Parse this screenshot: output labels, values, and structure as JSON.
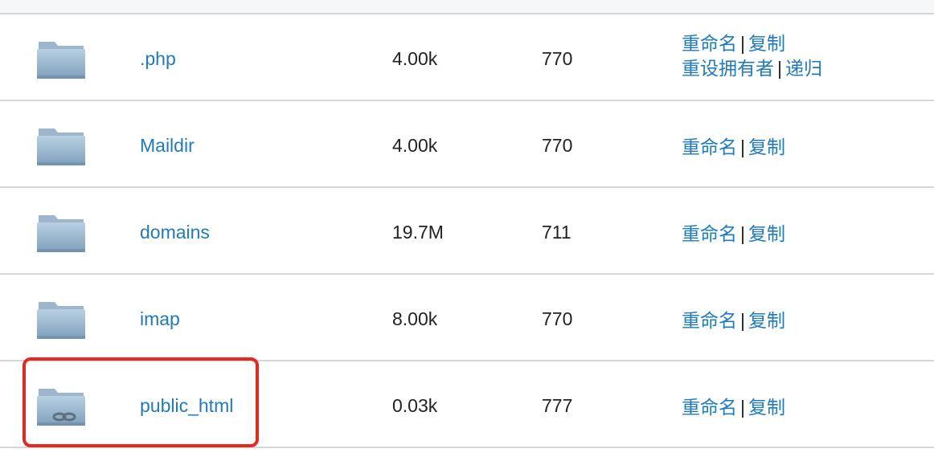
{
  "files": [
    {
      "name": ".php",
      "size": "4.00k",
      "permissions": "770",
      "icon": "folder-icon",
      "symlink": false,
      "actions": {
        "rename": "重命名",
        "separator": "|",
        "copy": "复制",
        "reset_owner": "重设拥有者",
        "recursive": "递归"
      }
    },
    {
      "name": "Maildir",
      "size": "4.00k",
      "permissions": "770",
      "icon": "folder-icon",
      "symlink": false,
      "actions": {
        "rename": "重命名",
        "separator": "|",
        "copy": "复制"
      }
    },
    {
      "name": "domains",
      "size": "19.7M",
      "permissions": "711",
      "icon": "folder-icon",
      "symlink": false,
      "actions": {
        "rename": "重命名",
        "separator": "|",
        "copy": "复制"
      }
    },
    {
      "name": "imap",
      "size": "8.00k",
      "permissions": "770",
      "icon": "folder-icon",
      "symlink": false,
      "actions": {
        "rename": "重命名",
        "separator": "|",
        "copy": "复制"
      }
    },
    {
      "name": "public_html",
      "size": "0.03k",
      "permissions": "777",
      "icon": "folder-link-icon",
      "symlink": true,
      "highlighted": true,
      "actions": {
        "rename": "重命名",
        "separator": "|",
        "copy": "复制"
      }
    }
  ],
  "colors": {
    "link": "#1f7ac2",
    "text": "#222222",
    "divider": "#d6d8db",
    "highlight": "#e8281e",
    "folder_top": "#a9c1d6",
    "folder_body": "#8fb0cb"
  }
}
